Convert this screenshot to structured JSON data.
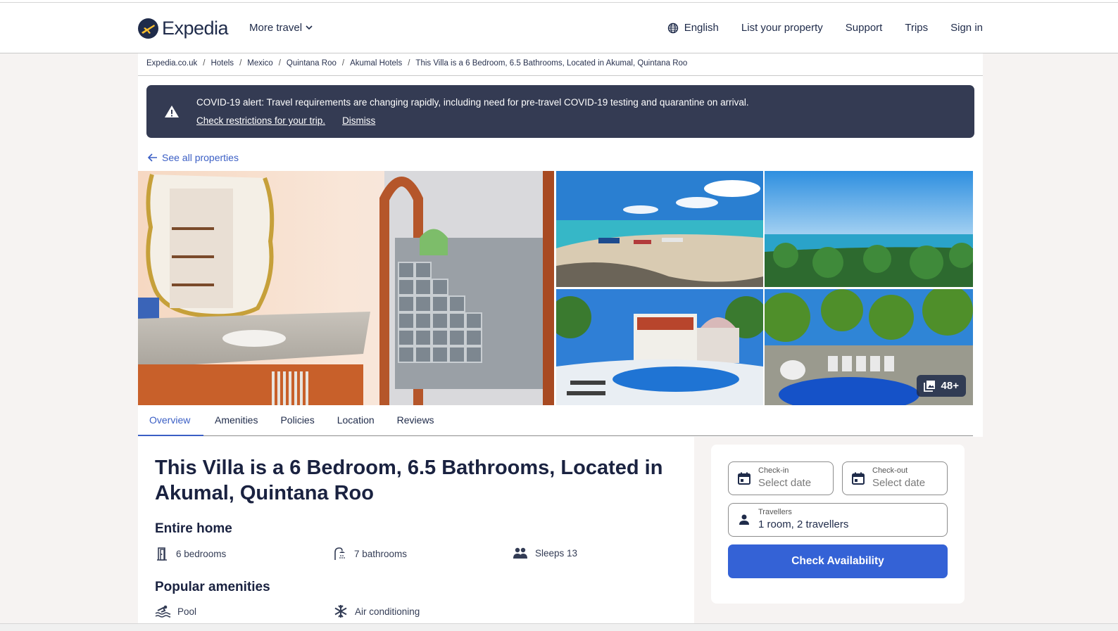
{
  "header": {
    "brand": "Expedia",
    "more_travel": "More travel",
    "nav": {
      "language": "English",
      "list_property": "List your property",
      "support": "Support",
      "trips": "Trips",
      "sign_in": "Sign in"
    }
  },
  "breadcrumb": [
    "Expedia.co.uk",
    "Hotels",
    "Mexico",
    "Quintana Roo",
    "Akumal Hotels",
    "This Villa is a 6 Bedroom, 6.5 Bathrooms, Located in Akumal, Quintana Roo"
  ],
  "covid_alert": {
    "message": "COVID-19 alert: Travel requirements are changing rapidly, including need for pre-travel COVID-19 testing and quarantine on arrival.",
    "check_link": "Check restrictions for your trip.",
    "dismiss": "Dismiss"
  },
  "see_all": "See all properties",
  "gallery": {
    "photo_count": "48+",
    "images": [
      "Bathroom vanity with ornate gold mirror and glass-block shower",
      "Beach with boats and turquoise water",
      "Aerial view of coastline and palm trees",
      "White villa with pool and palm trees",
      "Pool surrounded by palm trees and sun loungers"
    ]
  },
  "tabs": [
    {
      "label": "Overview",
      "active": true
    },
    {
      "label": "Amenities",
      "active": false
    },
    {
      "label": "Policies",
      "active": false
    },
    {
      "label": "Location",
      "active": false
    },
    {
      "label": "Reviews",
      "active": false
    }
  ],
  "property": {
    "title": "This Villa is a 6 Bedroom, 6.5 Bathrooms, Located in Akumal, Quintana Roo",
    "type": "Entire home",
    "features": [
      {
        "icon": "door-icon",
        "label": "6 bedrooms"
      },
      {
        "icon": "shower-icon",
        "label": "7 bathrooms"
      },
      {
        "icon": "people-icon",
        "label": "Sleeps 13"
      }
    ],
    "amenities_heading": "Popular amenities",
    "amenities": [
      {
        "icon": "pool-icon",
        "label": "Pool"
      },
      {
        "icon": "snowflake-icon",
        "label": "Air conditioning"
      }
    ]
  },
  "booking": {
    "check_in_label": "Check-in",
    "check_in_value": "Select date",
    "check_out_label": "Check-out",
    "check_out_value": "Select date",
    "travellers_label": "Travellers",
    "travellers_value": "1 room, 2 travellers",
    "button": "Check Availability"
  },
  "colors": {
    "brand_navy": "#1f2b4a",
    "link_blue": "#3b5fc5",
    "button_blue": "#3462d6",
    "alert_bg": "#343b53",
    "page_bg": "#f6f3f2"
  }
}
